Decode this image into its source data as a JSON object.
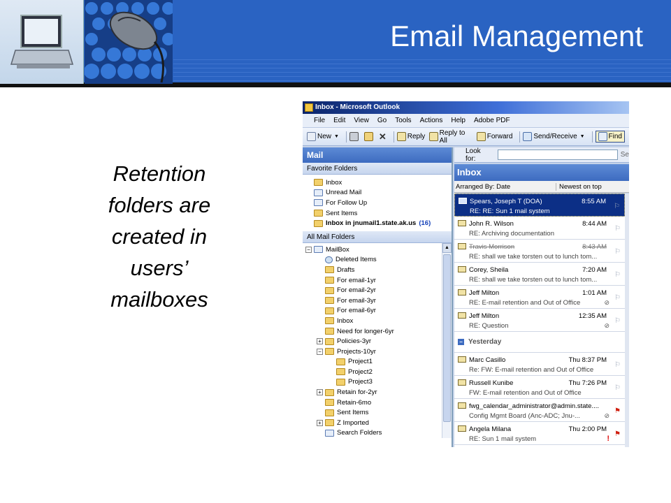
{
  "slide": {
    "title": "Email Management",
    "body": "Retention folders are created in users’ mailboxes"
  },
  "outlook": {
    "window_title": "Inbox - Microsoft Outlook",
    "menu": [
      "File",
      "Edit",
      "View",
      "Go",
      "Tools",
      "Actions",
      "Help",
      "Adobe PDF"
    ],
    "toolbar": {
      "new": "New",
      "reply": "Reply",
      "reply_all": "Reply to All",
      "forward": "Forward",
      "send_receive": "Send/Receive",
      "find": "Find"
    },
    "nav": {
      "header": "Mail",
      "favorites_header": "Favorite Folders",
      "favorites": [
        "Inbox",
        "Unread Mail",
        "For Follow Up",
        "Sent Items"
      ],
      "favorite_bold": "Inbox in jnumail1.state.ak.us",
      "favorite_bold_count": "(16)",
      "all_folders_header": "All Mail Folders",
      "root": "MailBox",
      "folders": [
        "Deleted Items",
        "Drafts",
        "For email-1yr",
        "For email-2yr",
        "For email-3yr",
        "For email-6yr",
        "Inbox",
        "Need for longer-6yr",
        "Policies-3yr",
        "Projects-10yr",
        "Project1",
        "Project2",
        "Project3",
        "Retain for-2yr",
        "Retain-6mo",
        "Sent Items",
        "Z Imported",
        "Search Folders"
      ]
    },
    "mail": {
      "look_for": "Look for:",
      "look_for_extra": "Se",
      "folder_title": "Inbox",
      "arranged_by": "Arranged By: Date",
      "sort_order": "Newest on top",
      "group_yesterday": "Yesterday",
      "messages": [
        {
          "from": "Spears, Joseph T (DOA)",
          "time": "8:55 AM",
          "subject": "RE: RE: Sun 1 mail system"
        },
        {
          "from": "John R. Wilson",
          "time": "8:44 AM",
          "subject": "RE: Archiving documentation"
        },
        {
          "from": "Travis Morrison",
          "time": "8:43 AM",
          "subject": "RE: shall we take torsten out to lunch tom..."
        },
        {
          "from": "Corey, Sheila",
          "time": "7:20 AM",
          "subject": "RE: shall we take torsten out to lunch tom..."
        },
        {
          "from": "Jeff Milton",
          "time": "1:01 AM",
          "subject": "RE: E-mail retention and Out of Office"
        },
        {
          "from": "Jeff Milton",
          "time": "12:35 AM",
          "subject": "RE: Question"
        },
        {
          "from": "Marc Casillo",
          "time": "Thu 8:37 PM",
          "subject": "Re: FW: E-mail retention and Out of Office"
        },
        {
          "from": "Russell Kunibe",
          "time": "Thu 7:26 PM",
          "subject": "FW: E-mail retention and Out of Office"
        },
        {
          "from": "fwg_calendar_administrator@admin.state....",
          "time": "",
          "subject": "Config Mgmt Board (Anc-ADC; Jnu-..."
        },
        {
          "from": "Angela Milana",
          "time": "Thu 2:00 PM",
          "subject": "RE: Sun 1 mail system"
        }
      ]
    }
  }
}
